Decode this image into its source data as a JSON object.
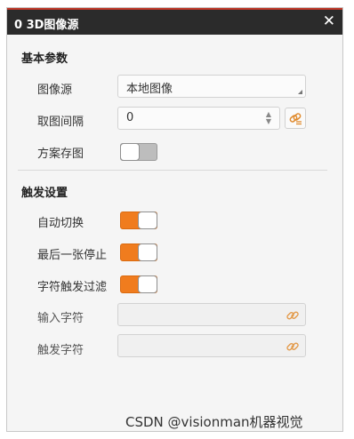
{
  "dialog": {
    "title": "0 3D图像源",
    "close_glyph": "✕"
  },
  "basic": {
    "title": "基本参数",
    "image_source": {
      "label": "图像源",
      "value": "本地图像"
    },
    "interval": {
      "label": "取图间隔",
      "value": "0"
    },
    "save_scheme": {
      "label": "方案存图",
      "state": "off"
    }
  },
  "trigger": {
    "title": "触发设置",
    "auto_switch": {
      "label": "自动切换",
      "state": "on"
    },
    "last_stop": {
      "label": "最后一张停止",
      "state": "on"
    },
    "char_filter": {
      "label": "字符触发过滤",
      "state": "on"
    },
    "input_chars": {
      "label": "输入字符",
      "value": ""
    },
    "trigger_chars": {
      "label": "触发字符",
      "value": ""
    }
  },
  "watermark": "CSDN @visionman机器视觉",
  "colors": {
    "accent": "#f07c1e",
    "titlebar": "#2b2b2b",
    "panel": "#f5f5f5"
  }
}
